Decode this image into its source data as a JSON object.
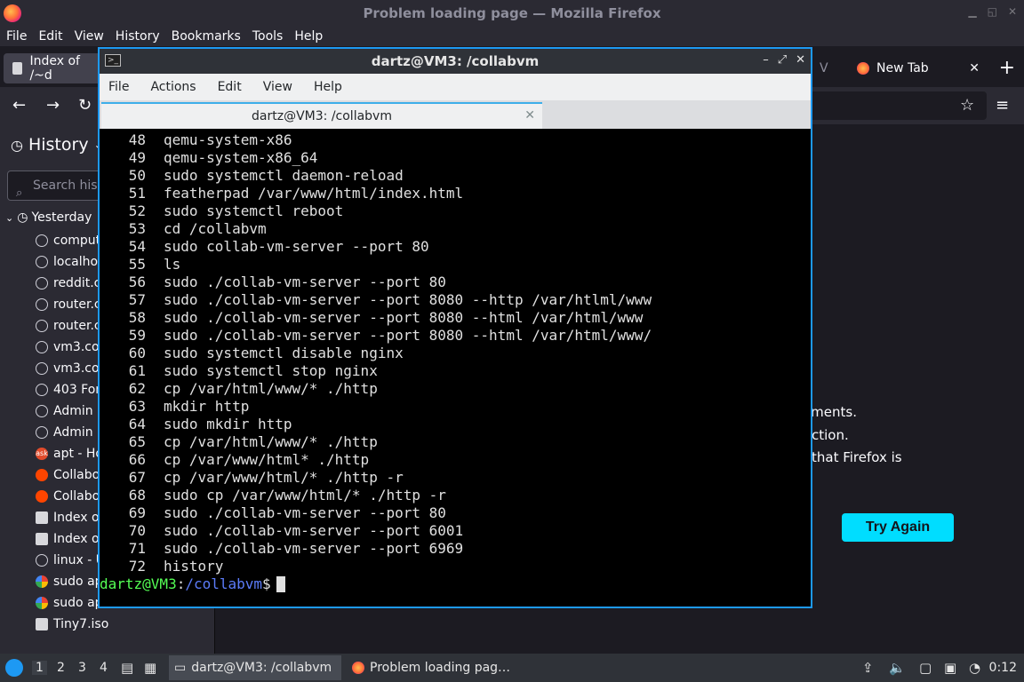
{
  "firefox": {
    "window_title": "Problem loading page — Mozilla Firefox",
    "menu": [
      "File",
      "Edit",
      "View",
      "History",
      "Bookmarks",
      "Tools",
      "Help"
    ],
    "tabs": [
      {
        "label": "Index of /~d"
      },
      {
        "label": "V"
      },
      {
        "label": "New Tab"
      }
    ],
    "sidebar": {
      "title": "History",
      "search_placeholder": "Search hist",
      "group": "Yesterday",
      "items": [
        {
          "label": "comput",
          "icon": "globe-icon"
        },
        {
          "label": "localhos",
          "icon": "globe-icon"
        },
        {
          "label": "reddit.c",
          "icon": "globe-icon"
        },
        {
          "label": "router.c",
          "icon": "globe-icon"
        },
        {
          "label": "router.c",
          "icon": "globe-icon"
        },
        {
          "label": "vm3.co",
          "icon": "globe-icon"
        },
        {
          "label": "vm3.co",
          "icon": "globe-icon"
        },
        {
          "label": "403 For",
          "icon": "globe-icon"
        },
        {
          "label": "Admin F",
          "icon": "globe-icon"
        },
        {
          "label": "Admin F",
          "icon": "globe-icon"
        },
        {
          "label": "apt - Ho",
          "icon": "ask-icon"
        },
        {
          "label": "Collabo",
          "icon": "reddit-icon"
        },
        {
          "label": "Collabo",
          "icon": "reddit-icon"
        },
        {
          "label": "Index of",
          "icon": "file-icon"
        },
        {
          "label": "Index of",
          "icon": "file-icon"
        },
        {
          "label": "linux - U",
          "icon": "globe-icon"
        },
        {
          "label": "sudo ap",
          "icon": "google-icon"
        },
        {
          "label": "sudo ap",
          "icon": "google-icon"
        },
        {
          "label": "Tiny7.iso",
          "icon": "file-icon"
        }
      ]
    },
    "error": {
      "line1": "oments.",
      "line2": "ction.",
      "line3": "that Firefox is",
      "button": "Try Again"
    }
  },
  "terminal": {
    "window_title": "dartz@VM3: /collabvm",
    "menu": [
      "File",
      "Actions",
      "Edit",
      "View",
      "Help"
    ],
    "tab_label": "dartz@VM3: /collabvm",
    "history": [
      {
        "n": "48",
        "cmd": "qemu-system-x86"
      },
      {
        "n": "49",
        "cmd": "qemu-system-x86_64"
      },
      {
        "n": "50",
        "cmd": "sudo systemctl daemon-reload"
      },
      {
        "n": "51",
        "cmd": "featherpad /var/www/html/index.html"
      },
      {
        "n": "52",
        "cmd": "sudo systemctl reboot"
      },
      {
        "n": "53",
        "cmd": "cd /collabvm"
      },
      {
        "n": "54",
        "cmd": "sudo collab-vm-server --port 80"
      },
      {
        "n": "55",
        "cmd": "ls"
      },
      {
        "n": "56",
        "cmd": "sudo ./collab-vm-server --port 80"
      },
      {
        "n": "57",
        "cmd": "sudo ./collab-vm-server --port 8080 --http /var/htlml/www"
      },
      {
        "n": "58",
        "cmd": "sudo ./collab-vm-server --port 8080 --html /var/html/www"
      },
      {
        "n": "59",
        "cmd": "sudo ./collab-vm-server --port 8080 --html /var/html/www/"
      },
      {
        "n": "60",
        "cmd": "sudo systemctl disable nginx"
      },
      {
        "n": "61",
        "cmd": "sudo systemctl stop nginx"
      },
      {
        "n": "62",
        "cmd": "cp /var/html/www/* ./http"
      },
      {
        "n": "63",
        "cmd": "mkdir http"
      },
      {
        "n": "64",
        "cmd": "sudo mkdir http"
      },
      {
        "n": "65",
        "cmd": "cp /var/html/www/* ./http"
      },
      {
        "n": "66",
        "cmd": "cp /var/www/html* ./http"
      },
      {
        "n": "67",
        "cmd": "cp /var/www/html/* ./http -r"
      },
      {
        "n": "68",
        "cmd": "sudo cp /var/www/html/* ./http -r"
      },
      {
        "n": "69",
        "cmd": "sudo ./collab-vm-server --port 80"
      },
      {
        "n": "70",
        "cmd": "sudo ./collab-vm-server --port 6001"
      },
      {
        "n": "71",
        "cmd": "sudo ./collab-vm-server --port 6969"
      },
      {
        "n": "72",
        "cmd": "history"
      }
    ],
    "prompt": {
      "user": "dartz@VM3",
      "sep": ":",
      "path": "/collabvm",
      "sym": "$"
    }
  },
  "taskbar": {
    "workspaces": [
      "1",
      "2",
      "3",
      "4"
    ],
    "tasks": [
      {
        "label": "dartz@VM3: /collabvm"
      },
      {
        "label": "Problem loading pag…"
      }
    ],
    "clock": "0:12"
  }
}
